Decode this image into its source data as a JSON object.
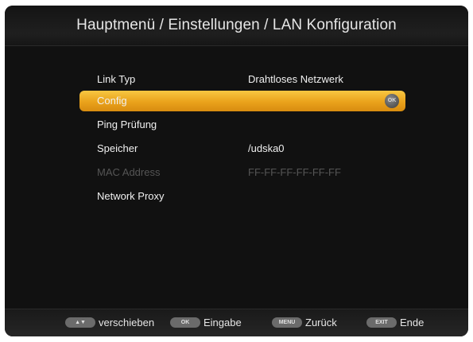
{
  "header": {
    "title": "Hauptmenü / Einstellungen / LAN Konfiguration"
  },
  "menu": {
    "items": [
      {
        "label": "Link Typ",
        "value": "Drahtloses Netzwerk",
        "state": "normal"
      },
      {
        "label": "Config",
        "value": "",
        "state": "selected",
        "icon": "ok-icon",
        "icon_text": "OK"
      },
      {
        "label": "Ping Prüfung",
        "value": "",
        "state": "normal"
      },
      {
        "label": "Speicher",
        "value": "/udska0",
        "state": "normal"
      },
      {
        "label": "MAC Address",
        "value": "FF-FF-FF-FF-FF-FF",
        "state": "disabled"
      },
      {
        "label": "Network Proxy",
        "value": "",
        "state": "normal"
      }
    ]
  },
  "footer": {
    "hints": [
      {
        "key": "▲▼",
        "label": "verschieben",
        "icon": "arrow-updown-key-icon"
      },
      {
        "key": "OK",
        "label": "Eingabe",
        "icon": "ok-key-icon"
      },
      {
        "key": "MENU",
        "label": "Zurück",
        "icon": "menu-key-icon"
      },
      {
        "key": "EXIT",
        "label": "Ende",
        "icon": "exit-key-icon"
      }
    ]
  },
  "colors": {
    "background": "#111111",
    "selection": "#eaa21b",
    "text": "#f0f0f0",
    "disabled_text": "#555555"
  }
}
